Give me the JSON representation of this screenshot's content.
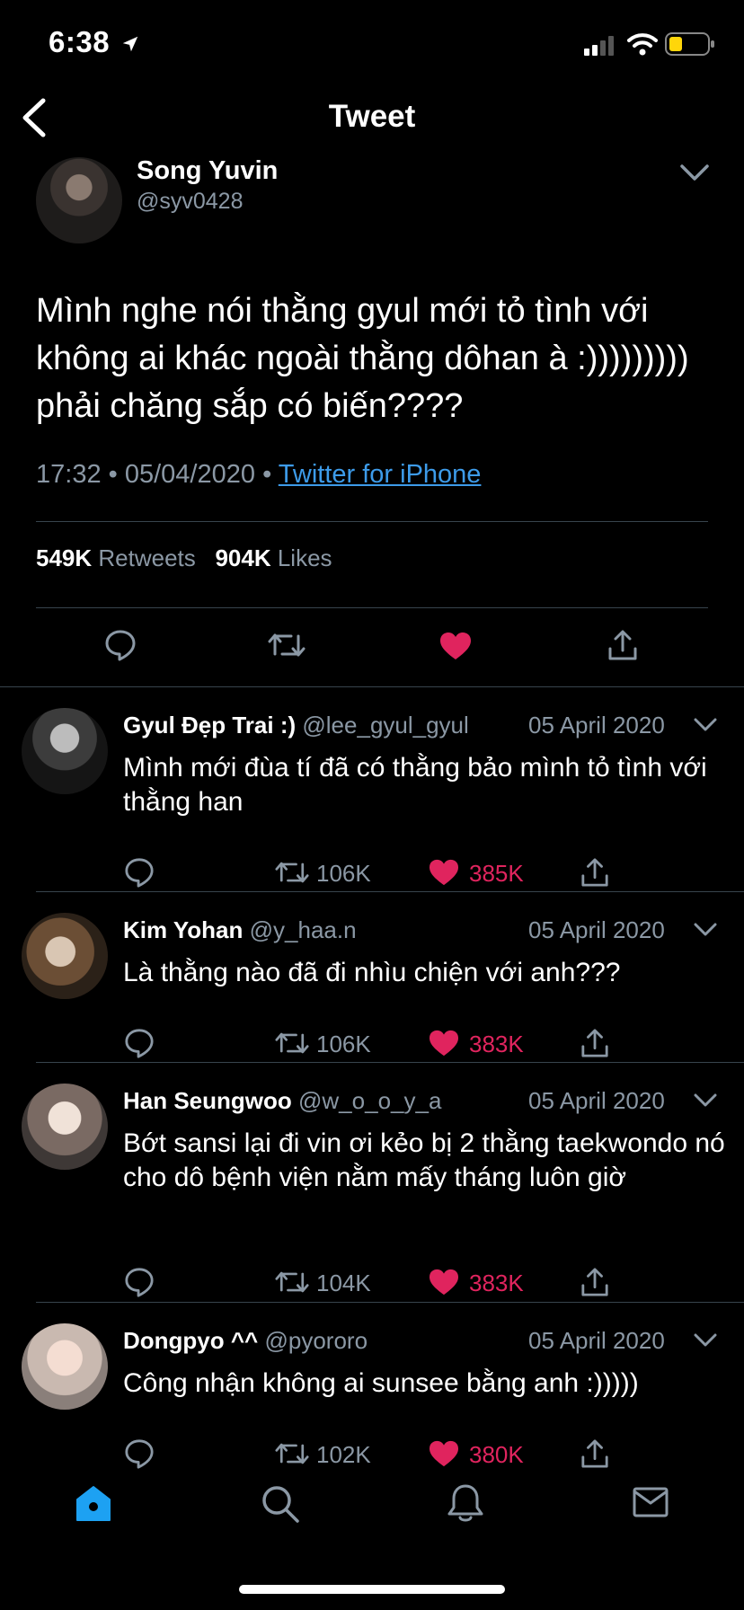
{
  "status_bar": {
    "time": "6:38"
  },
  "header": {
    "title": "Tweet"
  },
  "main_tweet": {
    "name": "Song Yuvin",
    "handle": "@syv0428",
    "text": "Mình nghe nói thằng gyul mới tỏ tình với không ai khác ngoài thằng dôhan à :))))))))) phải chăng sắp có biến????",
    "time": "17:32",
    "separator": "•",
    "date": "05/04/2020",
    "source": "Twitter for iPhone",
    "retweets": "549K",
    "retweets_label": "Retweets",
    "likes": "904K",
    "likes_label": "Likes"
  },
  "colors": {
    "accent": "#1da1f2",
    "like": "#e0245e",
    "secondary": "#8b98a5",
    "divider": "#38444d"
  },
  "replies": [
    {
      "name": "Gyul Đẹp Trai :)",
      "handle": "@lee_gyul_gyul",
      "date": "05 April 2020",
      "text": "Mình mới đùa tí đã có thằng bảo mình tỏ tình với thằng han",
      "retweets": "106K",
      "likes": "385K"
    },
    {
      "name": "Kim Yohan",
      "handle": "@y_haa.n",
      "date": "05 April 2020",
      "text": "Là thằng nào đã đi nhìu chiện với anh???",
      "retweets": "106K",
      "likes": "383K"
    },
    {
      "name": "Han Seungwoo",
      "handle": "@w_o_o_y_a",
      "date": "05 April 2020",
      "text": "Bớt sansi lại đi vin ơi kẻo bị 2 thằng taekwondo nó cho dô bệnh viện nằm mấy tháng luôn giờ",
      "retweets": "104K",
      "likes": "383K"
    },
    {
      "name": "Dongpyo ^^",
      "handle": "@pyororo",
      "date": "05 April 2020",
      "text": "Công nhận không ai sunsee bằng anh :)))))",
      "retweets": "102K",
      "likes": "380K"
    }
  ],
  "tab_bar": {
    "items": [
      "home-icon",
      "search-icon",
      "bell-icon",
      "mail-icon"
    ]
  }
}
